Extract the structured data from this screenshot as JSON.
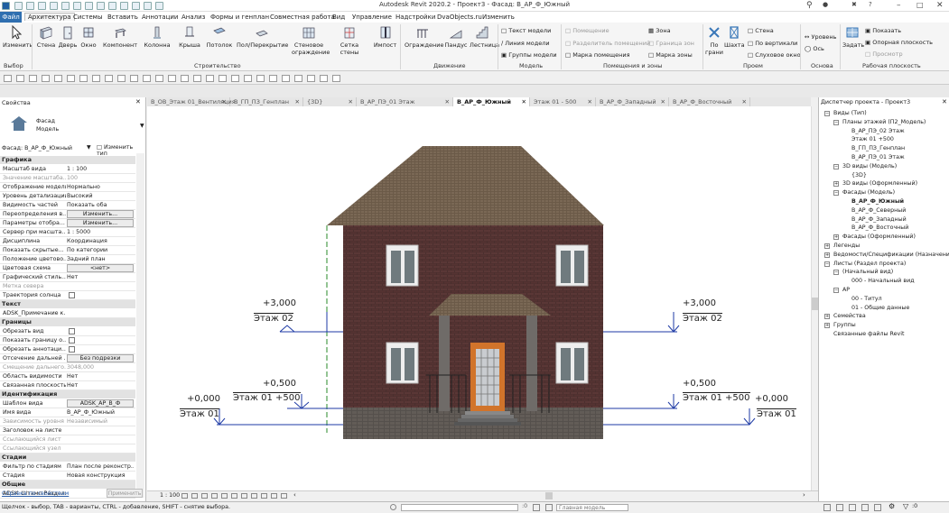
{
  "window": {
    "title": "Autodesk Revit 2020.2 - Проект3 - Фасад: В_АР_Ф_Южный"
  },
  "menu": {
    "file": "Файл",
    "items": [
      "Архитектура",
      "Системы",
      "Вставить",
      "Аннотации",
      "Анализ",
      "Формы и генплан",
      "Совместная работа",
      "Вид",
      "Управление",
      "Надстройки",
      "DvaObjects.ru",
      "Изменить"
    ]
  },
  "ribbon": {
    "modify": "Изменить",
    "select": "Выбор",
    "wall": "Стена",
    "door": "Дверь",
    "window": "Окно",
    "component": "Компонент",
    "column": "Колонна",
    "roof": "Крыша",
    "ceiling": "Потолок",
    "floor": "Пол/Перекрытие",
    "curtain_system": [
      "Стеновое",
      "ограждение"
    ],
    "curtain_grid": [
      "Сетка",
      "стены"
    ],
    "mullion": "Импост",
    "build_panel": "Строительство",
    "railing": "Ограждение",
    "ramp": "Пандус",
    "stair": "Лестница",
    "circulation_panel": "Движение",
    "model_text": "Текст модели",
    "model_line": "Линия модели",
    "model_group": "Группы модели",
    "model_panel": "Модель",
    "room": "Помещение",
    "room_sep": "Разделитель помещений",
    "tag_room": "Марка помещения",
    "area": "Зона",
    "area_boundary": "Граница зон",
    "tag_area": "Марка зоны",
    "room_panel": "Помещения и зоны",
    "by_face": [
      "По",
      "грани"
    ],
    "shaft": "Шахта",
    "wall_opening": "Стена",
    "vertical": "По вертикали",
    "dormer": "Слуховое окно",
    "opening_panel": "Проем",
    "level": "Уровень",
    "grid": "Ось",
    "datum_panel": "Основа",
    "set": "Задать",
    "show": "Показать",
    "ref_plane": "Опорная плоскость",
    "viewer": "Просмотр",
    "workplane_panel": "Рабочая плоскость"
  },
  "properties": {
    "title": "Свойства",
    "type_name": [
      "Фасад",
      "Модель"
    ],
    "selector": "Фасад: В_АР_Ф_Южный",
    "edit_type": "Изменить тип",
    "groups": [
      {
        "name": "Графика",
        "rows": [
          {
            "k": "Масштаб вида",
            "v": "1 : 100"
          },
          {
            "k": "Значение масштаба...",
            "v": "100",
            "dim": true
          },
          {
            "k": "Отображение модели",
            "v": "Нормально"
          },
          {
            "k": "Уровень детализации",
            "v": "Высокий"
          },
          {
            "k": "Видимость частей",
            "v": "Показать оба"
          },
          {
            "k": "Переопределения в...",
            "v": "Изменить...",
            "btn": true
          },
          {
            "k": "Параметры отобра...",
            "v": "Изменить...",
            "btn": true
          },
          {
            "k": "Сервер при масшта...",
            "v": "1 : 5000"
          },
          {
            "k": "Дисциплина",
            "v": "Координация"
          },
          {
            "k": "Показать скрытые...",
            "v": "По категории"
          },
          {
            "k": "Положение цветово...",
            "v": "Задний план"
          },
          {
            "k": "Цветовая схема",
            "v": "<нет>",
            "btn": true
          },
          {
            "k": "Графический стиль...",
            "v": "Нет"
          },
          {
            "k": "Метка севера",
            "v": "",
            "dim": true
          },
          {
            "k": "Траектория солнца",
            "v": "",
            "chk": true
          }
        ]
      },
      {
        "name": "Текст",
        "rows": [
          {
            "k": "ADSK_Примечание к...",
            "v": ""
          }
        ]
      },
      {
        "name": "Границы",
        "rows": [
          {
            "k": "Обрезать вид",
            "v": "",
            "chk": true
          },
          {
            "k": "Показать границу о...",
            "v": "",
            "chk": true
          },
          {
            "k": "Обрезать аннотаци...",
            "v": "",
            "chk": true
          },
          {
            "k": "Отсечение дальней ...",
            "v": "Без подрезки",
            "btn": true
          },
          {
            "k": "Смещение дальнего...",
            "v": "3048,000",
            "dim": true
          },
          {
            "k": "Область видимости",
            "v": "Нет"
          },
          {
            "k": "Связанная плоскость",
            "v": "Нет"
          }
        ]
      },
      {
        "name": "Идентификация",
        "rows": [
          {
            "k": "Шаблон вида",
            "v": "ADSK_АР_В_Ф",
            "btn": true
          },
          {
            "k": "Имя вида",
            "v": "В_АР_Ф_Южный"
          },
          {
            "k": "Зависимость уровня",
            "v": "Независимый",
            "dim": true
          },
          {
            "k": "Заголовок на листе",
            "v": ""
          },
          {
            "k": "Ссылающийся лист",
            "v": "",
            "dim": true
          },
          {
            "k": "Ссылающийся узел",
            "v": "",
            "dim": true
          }
        ]
      },
      {
        "name": "Стадии",
        "rows": [
          {
            "k": "Фильтр по стадиям",
            "v": "План после реконстр..."
          },
          {
            "k": "Стадия",
            "v": "Новая конструкция"
          }
        ]
      },
      {
        "name": "Общие",
        "rows": [
          {
            "k": "ADSK_Штамп Раздел...",
            "v": ""
          }
        ]
      }
    ],
    "help": "Справка по свойствам",
    "apply": "Применить"
  },
  "tabs": [
    {
      "label": "В_ОВ_Этаж 01_Вентиляция"
    },
    {
      "label": "В_ГП_ПЗ_Генплан"
    },
    {
      "label": "{3D}"
    },
    {
      "label": "В_АР_ПЭ_01 Этаж"
    },
    {
      "label": "В_АР_Ф_Южный",
      "active": true
    },
    {
      "label": "Этаж 01 - 500"
    },
    {
      "label": "В_АР_Ф_Западный"
    },
    {
      "label": "В_АР_Ф_Восточный"
    }
  ],
  "levels": {
    "l2_value": "+3,000",
    "l2_name": "Этаж 02",
    "l15_value": "+0,500",
    "l15_name": "Этаж 01 +500",
    "l1_value": "+0,000",
    "l1_name": "Этаж 01"
  },
  "view_bar": {
    "scale": "1 : 100"
  },
  "browser": {
    "title": "Диспетчер проекта - Проект3",
    "items": [
      {
        "t": "Виды (Тип)",
        "d": 0,
        "tg": "−"
      },
      {
        "t": "Планы этажей (П2_Модель)",
        "d": 1,
        "tg": "−"
      },
      {
        "t": "В_АР_ПЭ_02 Этаж",
        "d": 2
      },
      {
        "t": "Этаж 01 +500",
        "d": 2
      },
      {
        "t": "В_ГП_ПЗ_Генплан",
        "d": 2
      },
      {
        "t": "В_АР_ПЭ_01 Этаж",
        "d": 2
      },
      {
        "t": "3D виды (Модель)",
        "d": 1,
        "tg": "−"
      },
      {
        "t": "{3D}",
        "d": 2
      },
      {
        "t": "3D виды (Оформленный)",
        "d": 1,
        "tg": "+"
      },
      {
        "t": "Фасады (Модель)",
        "d": 1,
        "tg": "−"
      },
      {
        "t": "В_АР_Ф_Южный",
        "d": 2,
        "sel": true
      },
      {
        "t": "В_АР_Ф_Северный",
        "d": 2
      },
      {
        "t": "В_АР_Ф_Западный",
        "d": 2
      },
      {
        "t": "В_АР_Ф_Восточный",
        "d": 2
      },
      {
        "t": "Фасады (Оформленный)",
        "d": 1,
        "tg": "+"
      },
      {
        "t": "Легенды",
        "d": 0,
        "tg": "+"
      },
      {
        "t": "Ведомости/Спецификации (Назначение",
        "d": 0,
        "tg": "+"
      },
      {
        "t": "Листы (Раздел проекта)",
        "d": 0,
        "tg": "−"
      },
      {
        "t": "(Начальный вид)",
        "d": 1,
        "tg": "−"
      },
      {
        "t": "000 - Начальный вид",
        "d": 2
      },
      {
        "t": "АР",
        "d": 1,
        "tg": "−"
      },
      {
        "t": "00 - Титул",
        "d": 2
      },
      {
        "t": "01 - Общие данные",
        "d": 2
      },
      {
        "t": "Семейства",
        "d": 0,
        "tg": "+"
      },
      {
        "t": "Группы",
        "d": 0,
        "tg": "+"
      },
      {
        "t": "Связанные файлы Revit",
        "d": 0
      }
    ]
  },
  "status": {
    "hint": "Щелчок - выбор, TAB - варианты, CTRL - добавление, SHIFT - снятие выбора.",
    "model": "Главная модель",
    "count": ":0"
  }
}
